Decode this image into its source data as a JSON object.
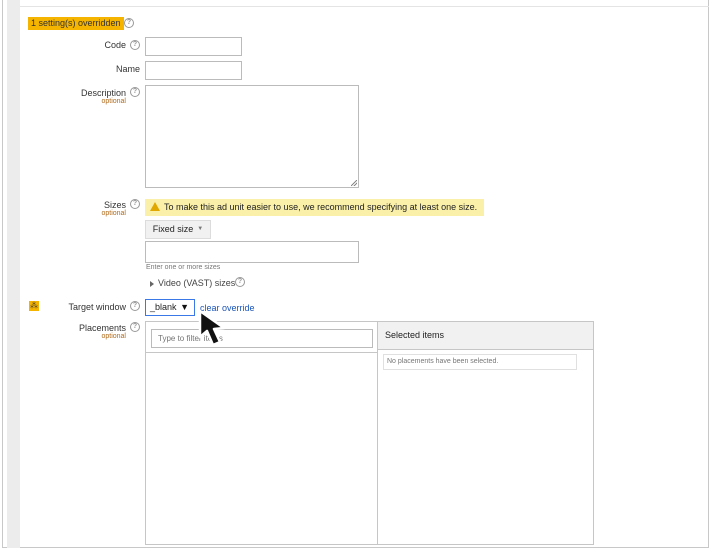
{
  "override_banner": {
    "text": "1 setting(s) overridden"
  },
  "help_glyph": "?",
  "fields": {
    "code": {
      "label": "Code",
      "value": ""
    },
    "name": {
      "label": "Name",
      "value": ""
    },
    "description": {
      "label": "Description",
      "optional": "optional",
      "value": ""
    },
    "sizes": {
      "label": "Sizes",
      "optional": "optional",
      "warning": "To make this ad unit easier to use, we recommend specifying at least one size.",
      "fixed_size_label": "Fixed size",
      "input_value": "",
      "hint": "Enter one or more sizes",
      "vast_label": "Video (VAST) sizes"
    },
    "target_window": {
      "label": "Target window",
      "selected": "_blank",
      "clear_override": "clear override"
    },
    "placements": {
      "label": "Placements",
      "optional": "optional",
      "filter_placeholder": "Type to filter items",
      "selected_header": "Selected items",
      "empty_text": "No placements have been selected."
    }
  },
  "colors": {
    "override": "#f4b400",
    "warning_bg": "#fbf0a9",
    "link": "#1a55b8",
    "optional_text": "#b06a1a"
  },
  "icons": {
    "help": "help-circle-icon",
    "warning": "warning-triangle-icon",
    "override": "override-marker-icon",
    "dropdown": "dropdown-arrow-icon",
    "expand": "expand-triangle-icon",
    "cursor": "mouse-pointer-icon"
  }
}
